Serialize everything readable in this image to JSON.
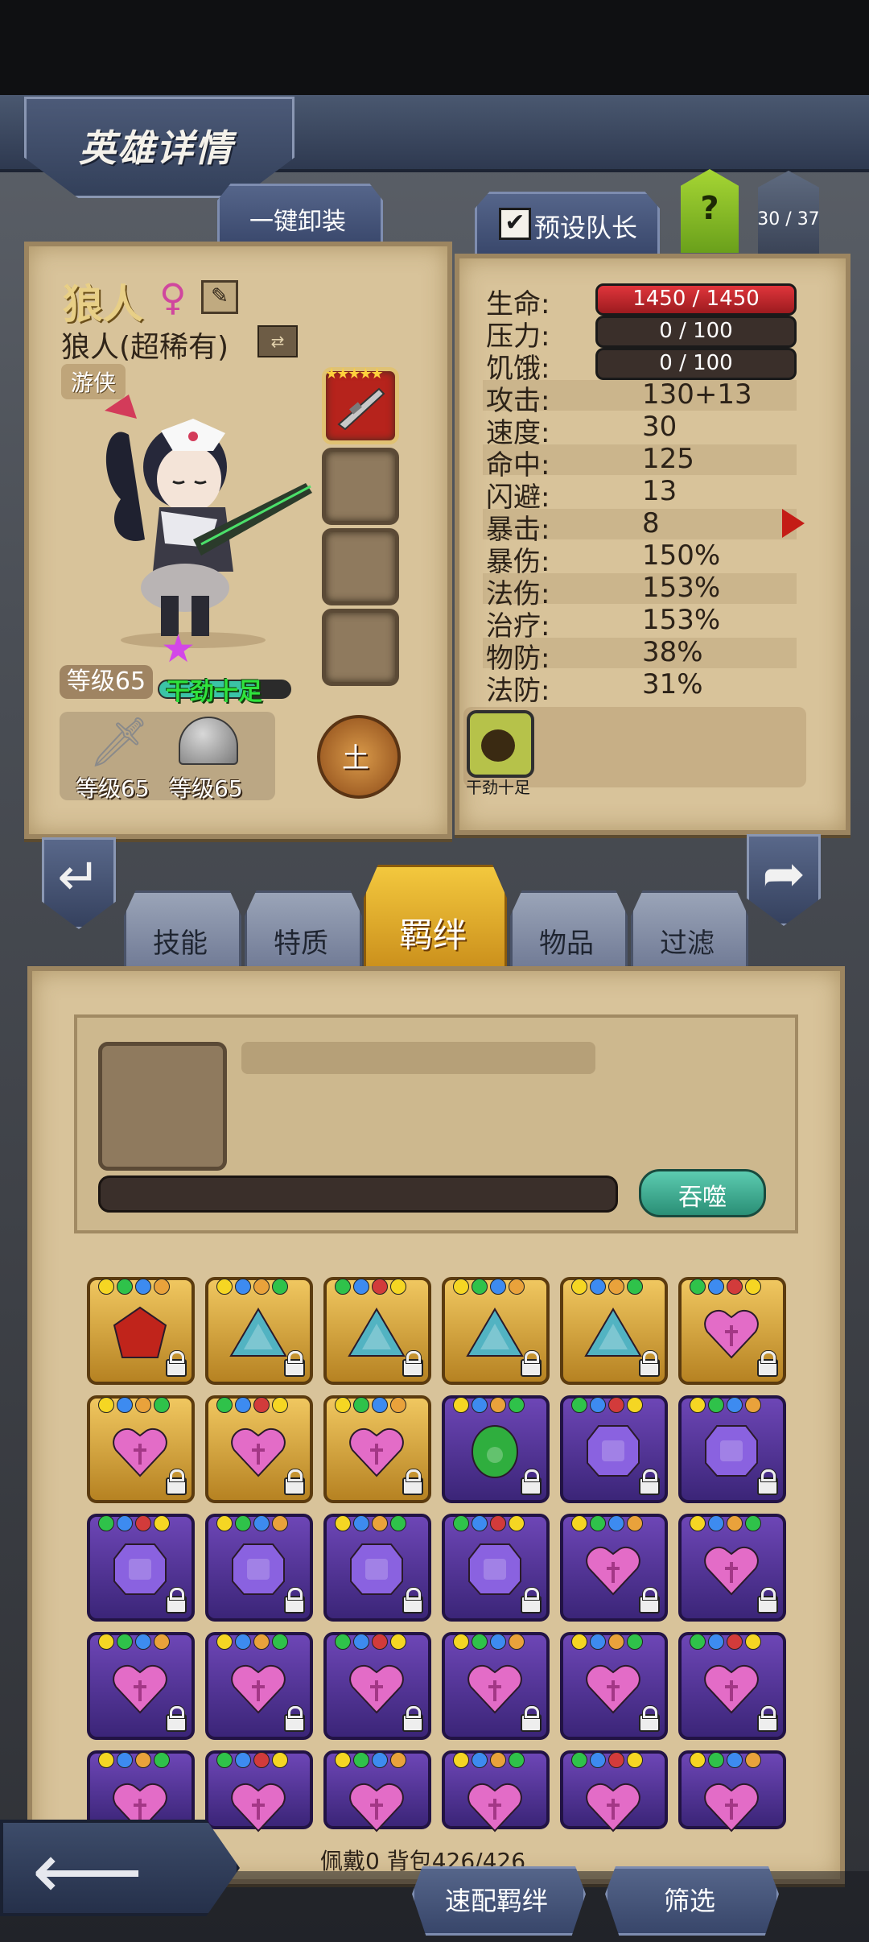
{
  "header": {
    "title": "英雄详情",
    "unequip_all": "一键卸装",
    "preset_leader": "预设队长",
    "preset_checked": "✔",
    "help": "?",
    "team_count": "30 / 37"
  },
  "hero": {
    "name": "狼人",
    "gender_icon": "♀",
    "edit_icon": "✎",
    "subname": "狼人(超稀有)",
    "swap_icon": "⇄",
    "class": "游侠",
    "level": "等级65",
    "mood": "干劲十足",
    "star_icon": "★",
    "weapon_slot_stars": "★★★★★",
    "weapon_level": "等级65",
    "armor_level": "等级65",
    "element": "土"
  },
  "stats": {
    "hp_label": "生命:",
    "hp_value": "1450 / 1450",
    "stress_label": "压力:",
    "stress_value": "0 / 100",
    "hunger_label": "饥饿:",
    "hunger_value": "0 / 100",
    "attack_label": "攻击:",
    "attack_value": "130+13",
    "speed_label": "速度:",
    "speed_value": "30",
    "hit_label": "命中:",
    "hit_value": "125",
    "dodge_label": "闪避:",
    "dodge_value": "13",
    "crit_label": "暴击:",
    "crit_value": "8",
    "critdmg_label": "暴伤:",
    "critdmg_value": "150%",
    "magicdmg_label": "法伤:",
    "magicdmg_value": "153%",
    "heal_label": "治疗:",
    "heal_value": "153%",
    "pdef_label": "物防:",
    "pdef_value": "38%",
    "mdef_label": "法防:",
    "mdef_value": "31%",
    "buff_label": "干劲十足"
  },
  "tabs": {
    "skills": "技能",
    "traits": "特质",
    "bonds": "羁绊",
    "items": "物品",
    "filter": "过滤"
  },
  "feed": {
    "devour": "吞噬"
  },
  "bottom": {
    "info": "佩戴0 背包426/426",
    "match": "速配羁绊",
    "filter": "筛选",
    "back_icon": "⟵",
    "prev_icon": "↵",
    "next_icon": "➦"
  },
  "colors": {
    "red_gem": "#c0241b",
    "cyan_gem": "#52b3c2",
    "pink_gem": "#e36cc7",
    "green_gem": "#2fae3e",
    "violet_gem": "#8a62e0"
  }
}
